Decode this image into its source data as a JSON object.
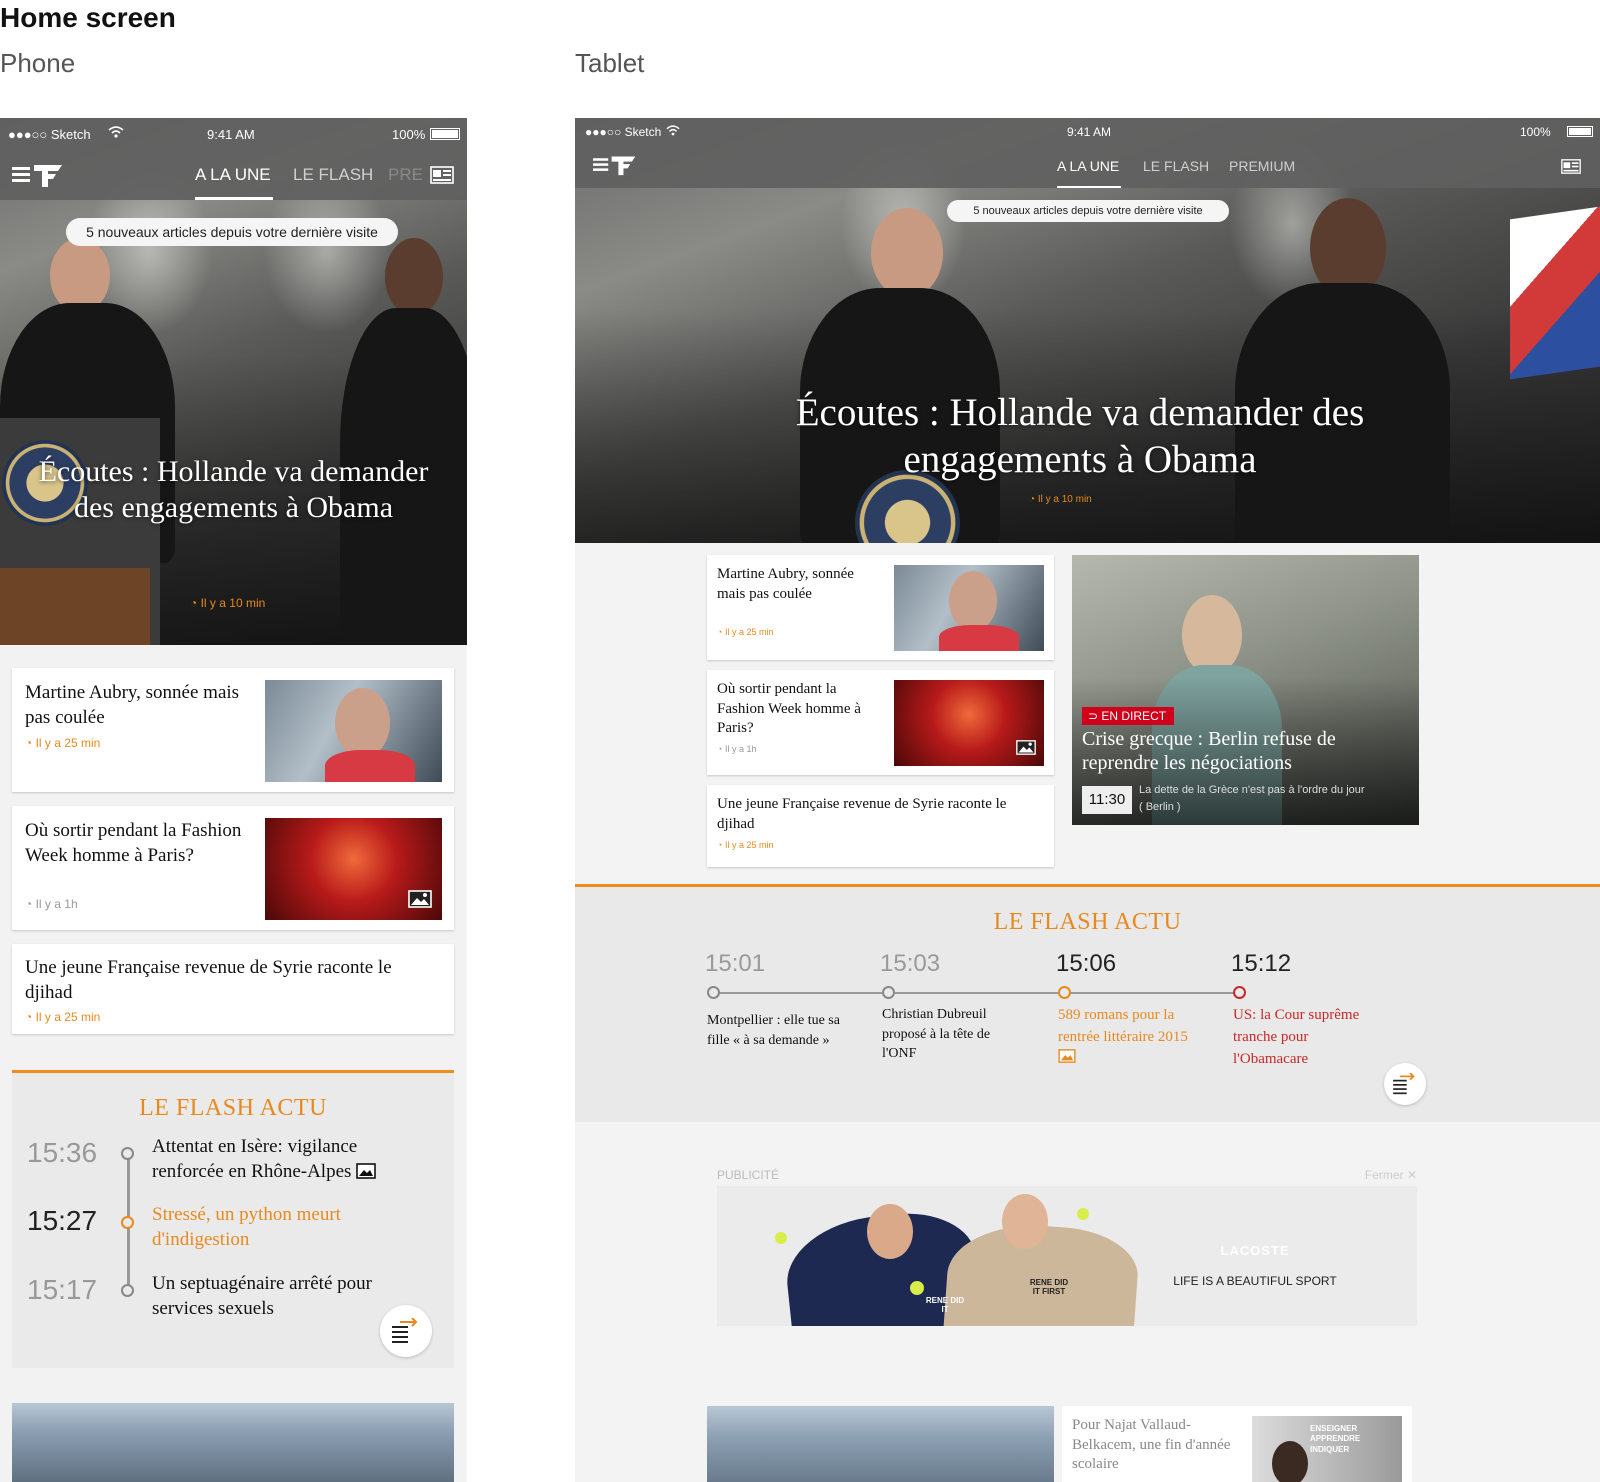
{
  "page": {
    "title": "Home screen",
    "phone_label": "Phone",
    "tablet_label": "Tablet"
  },
  "phone": {
    "status": {
      "carrier": "●●●○○ Sketch",
      "time": "9:41 AM",
      "battery": "100%"
    },
    "tabs": [
      "A LA UNE",
      "LE FLASH",
      "PRE"
    ],
    "banner": "5 nouveaux articles depuis votre dernière visite",
    "hero": {
      "title": "Écoutes : Hollande va demander des engagements à Obama",
      "time": "Il y a 10 min"
    },
    "articles": [
      {
        "title": "Martine Aubry, sonnée mais pas coulée",
        "time": "Il y a 25 min"
      },
      {
        "title": "Où sortir pendant la Fashion Week homme à Paris?",
        "time": "Il y a 1h"
      },
      {
        "title": "Une jeune Française revenue de Syrie raconte le djihad",
        "time": "Il y a 25 min"
      }
    ],
    "flash": {
      "title": "LE FLASH ACTU",
      "items": [
        {
          "time": "15:36",
          "text": "Attentat en Isère: vigilance renforcée en Rhône-Alpes"
        },
        {
          "time": "15:27",
          "text": "Stressé, un python meurt d'indigestion"
        },
        {
          "time": "15:17",
          "text": "Un septuagénaire arrêté pour services sexuels"
        }
      ]
    }
  },
  "tablet": {
    "status": {
      "carrier": "●●●○○ Sketch",
      "time": "9:41 AM",
      "battery": "100%"
    },
    "tabs": [
      "A LA UNE",
      "LE FLASH",
      "PREMIUM"
    ],
    "banner": "5 nouveaux articles depuis votre dernière visite",
    "hero": {
      "title": "Écoutes : Hollande va demander des engagements à Obama",
      "time": "Il y a 10 min"
    },
    "articles": [
      {
        "title": "Martine Aubry, sonnée mais pas coulée",
        "time": "Il y a 25 min"
      },
      {
        "title": "Où sortir pendant la Fashion Week homme à Paris?",
        "time": "Il y a 1h"
      },
      {
        "title": "Une jeune Française revenue de Syrie raconte le djihad",
        "time": "Il y a 25 min"
      }
    ],
    "live": {
      "badge": "EN DIRECT",
      "title": "Crise grecque : Berlin refuse de reprendre les négociations",
      "time": "11:30",
      "caption": "La dette de la Grèce n'est pas à l'ordre du jour",
      "caption_location": "( Berlin )"
    },
    "flash": {
      "title": "LE FLASH ACTU",
      "items": [
        {
          "time": "15:01",
          "text": "Montpellier : elle tue sa fille « à sa demande »"
        },
        {
          "time": "15:03",
          "text": "Christian Dubreuil proposé à la tête de l'ONF"
        },
        {
          "time": "15:06",
          "text": "589 romans pour la rentrée littéraire 2015"
        },
        {
          "time": "15:12",
          "text": "US: la Cour suprême tranche pour l'Obamacare"
        }
      ]
    },
    "ad": {
      "label": "PUBLICITÉ",
      "close": "Fermer",
      "brand": "LACOSTE",
      "tagline": "LIFE IS A BEAUTIFUL SPORT",
      "shirt1": "RENE DID IT",
      "shirt2": "RENE DID IT FIRST"
    },
    "bottom_article": {
      "title": "Pour Najat Vallaud-Belkacem, une fin d'année scolaire",
      "thumb_text": "ENSEIGNER APPRENDRE INDIQUER"
    }
  },
  "colors": {
    "accent": "#e8891e",
    "live_red": "#d0021b",
    "flash_red": "#c62828",
    "nav_bg": "#5f5f5f"
  }
}
